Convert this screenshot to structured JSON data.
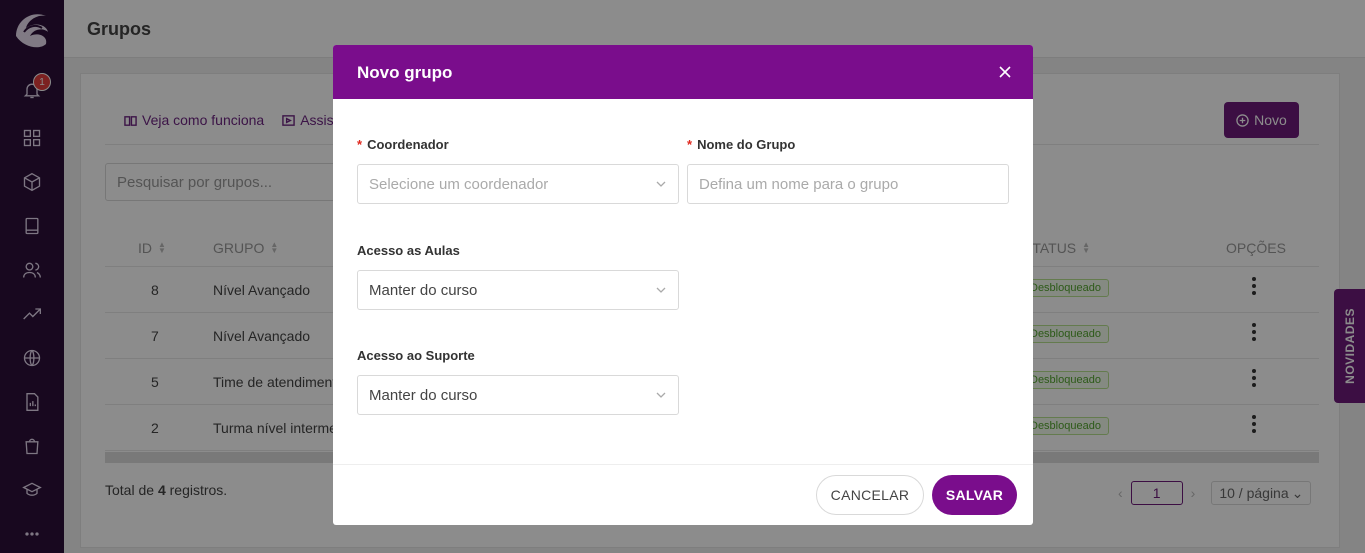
{
  "header": {
    "title": "Grupos"
  },
  "sidebar": {
    "notification_count": "1",
    "icons": [
      "bell-icon",
      "dashboard-icon",
      "box-icon",
      "book-icon",
      "users-icon",
      "trending-icon",
      "globe-icon",
      "report-icon",
      "shopping-bag-icon",
      "graduation-cap-icon",
      "more-icon"
    ]
  },
  "toolbar": {
    "link_how_it_works": "Veja como funciona",
    "link_watch": "Assist",
    "new_button": "Novo"
  },
  "search": {
    "placeholder": "Pesquisar por grupos..."
  },
  "table": {
    "columns": {
      "id": "ID",
      "group": "GRUPO",
      "status": "STATUS",
      "options": "OPÇÕES"
    },
    "rows": [
      {
        "id": "8",
        "group": "Nível Avançado",
        "status": "Desbloqueado"
      },
      {
        "id": "7",
        "group": "Nível Avançado",
        "status": "Desbloqueado"
      },
      {
        "id": "5",
        "group": "Time de atendiment",
        "status": "Desbloqueado"
      },
      {
        "id": "2",
        "group": "Turma nível interme",
        "status": "Desbloqueado"
      }
    ]
  },
  "footer": {
    "total_prefix": "Total de",
    "total_count": "4",
    "total_suffix": "registros.",
    "current_page": "1",
    "page_size": "10 / página"
  },
  "side_tab": {
    "label": "NOVIDADES"
  },
  "modal": {
    "title": "Novo grupo",
    "coordinator_label": "Coordenador",
    "coordinator_placeholder": "Selecione um coordenador",
    "group_name_label": "Nome do Grupo",
    "group_name_placeholder": "Defina um nome para o grupo",
    "class_access_label": "Acesso as Aulas",
    "class_access_value": "Manter do curso",
    "support_access_label": "Acesso ao Suporte",
    "support_access_value": "Manter do curso",
    "cancel_label": "CANCELAR",
    "save_label": "SALVAR"
  },
  "colors": {
    "brand": "#7a0d8c",
    "sidebar": "#2c0f3a",
    "required": "#e0281e",
    "status_green": "#52a52e"
  }
}
